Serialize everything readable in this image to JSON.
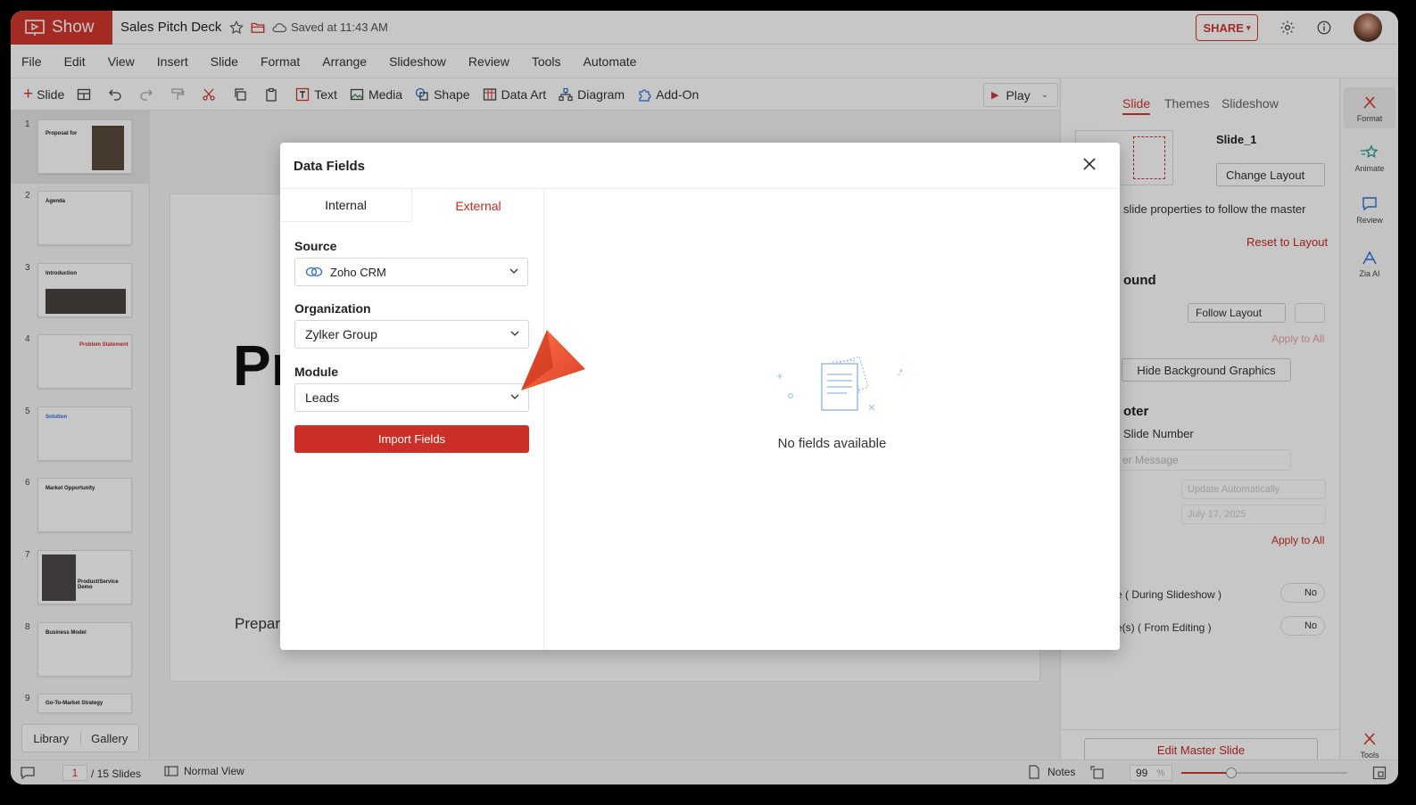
{
  "app": {
    "brand": "Show",
    "doc_title": "Sales Pitch Deck",
    "save_status": "Saved at 11:43 AM",
    "share_label": "SHARE"
  },
  "menu": [
    "File",
    "Edit",
    "View",
    "Insert",
    "Slide",
    "Format",
    "Arrange",
    "Slideshow",
    "Review",
    "Tools",
    "Automate"
  ],
  "toolbar": {
    "slide": "Slide",
    "text": "Text",
    "media": "Media",
    "shape": "Shape",
    "data_art": "Data Art",
    "diagram": "Diagram",
    "add_on": "Add-On",
    "play": "Play"
  },
  "slides": [
    {
      "num": "1",
      "title": "Proposal for"
    },
    {
      "num": "2",
      "title": "Agenda"
    },
    {
      "num": "3",
      "title": "Introduction"
    },
    {
      "num": "4",
      "title": "Problem Statement"
    },
    {
      "num": "5",
      "title": "Solution"
    },
    {
      "num": "6",
      "title": "Market Opportunity"
    },
    {
      "num": "7",
      "title": "Product/Service Demo"
    },
    {
      "num": "8",
      "title": "Business Model"
    },
    {
      "num": "9",
      "title": "Go-To-Market Strategy"
    }
  ],
  "slide_panel": {
    "library": "Library",
    "gallery": "Gallery"
  },
  "canvas": {
    "big_text": "Pr",
    "prepared_text": "Prepar"
  },
  "right_panel": {
    "tabs": [
      "Slide",
      "Themes",
      "Slideshow"
    ],
    "slide_name": "Slide_1",
    "change_layout": "Change Layout",
    "follow_master": "slide properties to follow the master",
    "reset_layout": "Reset to Layout",
    "background_heading": "ound",
    "follow_layout": "Follow Layout",
    "apply_all_disabled": "Apply to All",
    "hide_bg": "Hide Background Graphics",
    "footer_heading": "oter",
    "slide_number": "Slide Number",
    "footer_msg": "er Message",
    "update_auto": "Update Automatically",
    "date": "July 17, 2025",
    "apply_all": "Apply to All",
    "during_slideshow": "e ( During Slideshow )",
    "from_editing": "e(s) ( From Editing )",
    "toggle_no": "No",
    "edit_master": "Edit Master Slide"
  },
  "rail": {
    "format": "Format",
    "animate": "Animate",
    "review": "Review",
    "zia": "Zia AI",
    "tools": "Tools"
  },
  "status": {
    "page": "1",
    "total": "/ 15 Slides",
    "view": "Normal View",
    "notes": "Notes",
    "zoom": "99",
    "zoom_unit": "%"
  },
  "dialog": {
    "title": "Data Fields",
    "tabs": {
      "internal": "Internal",
      "external": "External"
    },
    "source_label": "Source",
    "source_value": "Zoho CRM",
    "org_label": "Organization",
    "org_value": "Zylker Group",
    "module_label": "Module",
    "module_value": "Leads",
    "import_label": "Import Fields",
    "empty_text": "No fields available"
  },
  "colors": {
    "brand": "#d2362f",
    "accent": "#c8281f"
  }
}
